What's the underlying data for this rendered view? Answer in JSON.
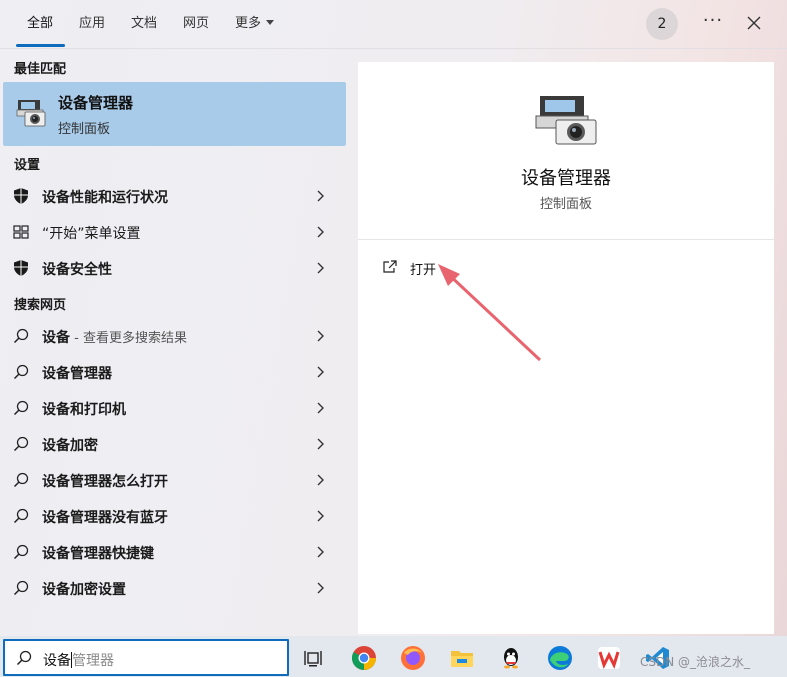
{
  "tabs": [
    {
      "label": "全部"
    },
    {
      "label": "应用"
    },
    {
      "label": "文档"
    },
    {
      "label": "网页"
    },
    {
      "label": "更多"
    }
  ],
  "header": {
    "badge_count": "2",
    "more_icon": "ellipsis-icon",
    "close_icon": "close-icon"
  },
  "sections": {
    "best_match": "最佳匹配",
    "settings": "设置",
    "web_search": "搜索网页"
  },
  "best_match": {
    "title": "设备管理器",
    "subtitle": "控制面板",
    "icon": "device-manager-icon"
  },
  "settings_items": [
    {
      "label": "设备性能和运行状况",
      "icon": "shield-icon"
    },
    {
      "label": "“开始”菜单设置",
      "icon": "start-layout-icon"
    },
    {
      "label": "设备安全性",
      "icon": "shield-icon"
    }
  ],
  "web_items": [
    {
      "label": "设备",
      "suffix": " - 查看更多搜索结果"
    },
    {
      "label": "设备管理器"
    },
    {
      "label": "设备和打印机"
    },
    {
      "label": "设备加密"
    },
    {
      "label": "设备管理器怎么打开"
    },
    {
      "label": "设备管理器没有蓝牙"
    },
    {
      "label": "设备管理器快捷键"
    },
    {
      "label": "设备加密设置"
    }
  ],
  "detail": {
    "title": "设备管理器",
    "subtitle": "控制面板",
    "action_open": "打开"
  },
  "search": {
    "typed": "设备",
    "suggestion": "管理器"
  },
  "taskbar": {
    "icons": [
      "task-view-icon",
      "chrome-icon",
      "firefox-icon",
      "file-explorer-icon",
      "qq-icon",
      "edge-icon",
      "wps-icon",
      "vscode-icon"
    ]
  },
  "watermark": "CSDN @_沧浪之水_",
  "colors": {
    "accent": "#0f6cbd",
    "selected": "#a8cbea",
    "annotation_arrow": "#e8646e"
  }
}
